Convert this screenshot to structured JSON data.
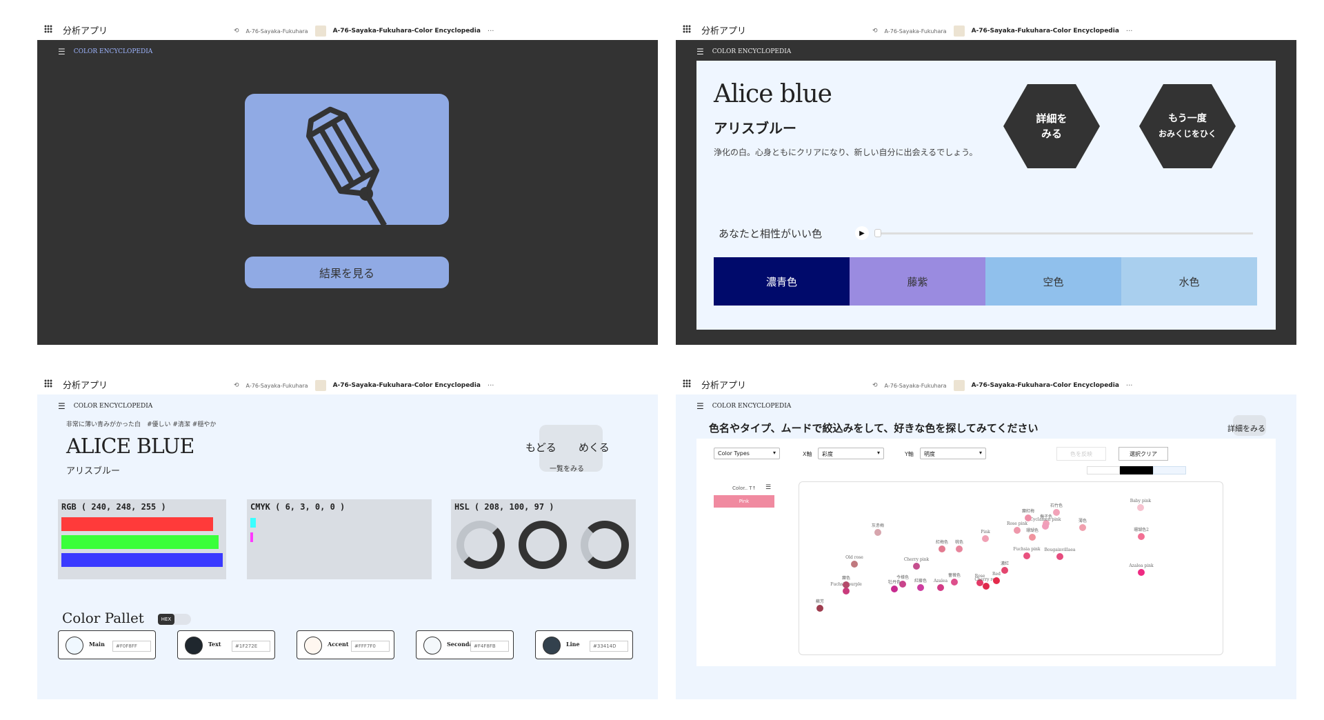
{
  "window": {
    "app_name": "分析アプリ",
    "owner": "A-76-Sayaka-Fukuhara",
    "doc_title": "A-76-Sayaka-Fukuhara-Color Encyclopedia",
    "more": "···"
  },
  "brand": "COLOR ENCYCLOPEDIA",
  "screen1": {
    "result_button": "結果を見る",
    "card_color": "#90aae4"
  },
  "screen2": {
    "name_en": "Alice blue",
    "name_ja": "アリスブルー",
    "description": "浄化の白。心身ともにクリアになり、新しい自分に出会えるでしょう。",
    "detail_button": [
      "詳細を",
      "みる"
    ],
    "retry_button": [
      "もう一度",
      "おみくじをひく"
    ],
    "match_label": "あなたと相性がいい色",
    "matches": [
      {
        "name": "濃青色",
        "color": "#000a6b",
        "text_color": "#ffffff"
      },
      {
        "name": "藤紫",
        "color": "#9a8be0",
        "text_color": "#333333"
      },
      {
        "name": "空色",
        "color": "#90c0ec",
        "text_color": "#333333"
      },
      {
        "name": "水色",
        "color": "#a9cfee",
        "text_color": "#333333"
      }
    ]
  },
  "screen3": {
    "tags": "非常に薄い青みがかった白　#優しい #清潔 #穏やか",
    "title": "ALICE BLUE",
    "kana": "アリスブルー",
    "nav_back": "もどる",
    "nav_next": "めくる",
    "nav_list": "一覧をみる",
    "rgb_label": "RGB ( 240, 248, 255 )",
    "rgb_values": [
      240,
      248,
      255
    ],
    "cmyk_label": "CMYK ( 6, 3, 0, 0 )",
    "cmyk_values": [
      6,
      3,
      0,
      0
    ],
    "hsl_label": "HSL ( 208, 100, 97 )",
    "hsl_values": [
      208,
      100,
      97
    ],
    "pallet_title": "Color Pallet",
    "toggle_label": "HEX",
    "pallet": [
      {
        "name": "Main",
        "hex": "#F0F8FF",
        "color": "#f0f8ff"
      },
      {
        "name": "Text",
        "hex": "#1F272E",
        "color": "#1f272e"
      },
      {
        "name": "Accent",
        "hex": "#FFF7F0",
        "color": "#fff7f0"
      },
      {
        "name": "Secondary",
        "hex": "#F4F8FB",
        "color": "#f4f8fb"
      },
      {
        "name": "Line",
        "hex": "#33414D",
        "color": "#33414d"
      }
    ]
  },
  "screen4": {
    "title": "色名やタイプ、ムードで絞込みをして、好きな色を探してみてください",
    "detail_link": "詳細をみる",
    "color_types": "Color Types",
    "x_axis_label": "X軸",
    "x_axis_value": "彩度",
    "y_axis_label": "Y軸",
    "y_axis_value": "明度",
    "ghost_button": "色を反映",
    "clear_button": "選択クリア",
    "filter_header": "Color.. T↑",
    "filter_chip": "Pink",
    "points": [
      {
        "label": "蘇芳",
        "color": "#9e3d4f"
      },
      {
        "label": "Old rose",
        "color": "#c0797f"
      },
      {
        "label": "灰赤梅",
        "color": "#d7a5ad"
      },
      {
        "label": "Fuchsia purple",
        "color": "#c93b7c"
      },
      {
        "label": "躑色",
        "color": "#b44b6b"
      },
      {
        "label": "Cherry pink",
        "color": "#c54f8e"
      },
      {
        "label": "今様色",
        "color": "#c9448b"
      },
      {
        "label": "牡丹色",
        "color": "#c72b8f"
      },
      {
        "label": "紅藤色",
        "color": "#cd3ca0"
      },
      {
        "label": "Azalea",
        "color": "#d33a86"
      },
      {
        "label": "紅梅色",
        "color": "#e27a8f"
      },
      {
        "label": "桃色",
        "color": "#e7859c"
      },
      {
        "label": "薔薇色",
        "color": "#dd4f8c"
      },
      {
        "label": "Rose",
        "color": "#e43a67"
      },
      {
        "label": "Cherry red",
        "color": "#df2a4c"
      },
      {
        "label": "Red",
        "color": "#e42a4b"
      },
      {
        "label": "濃紅",
        "color": "#e3466f"
      },
      {
        "label": "Pink",
        "color": "#f0a0b4"
      },
      {
        "label": "Rose pink",
        "color": "#ee98ab"
      },
      {
        "label": "Fuchsia pink",
        "color": "#e9517f"
      },
      {
        "label": "撫子色",
        "color": "#f1a2b8"
      },
      {
        "label": "Cyclamen pink",
        "color": "#f09dba"
      },
      {
        "label": "石竹色",
        "color": "#f2a3b9"
      },
      {
        "label": "珊瑚色",
        "color": "#f0949e"
      },
      {
        "label": "躑紅梅",
        "color": "#ee8fa7"
      },
      {
        "label": "Bougainvillaea",
        "color": "#e64c7e"
      },
      {
        "label": "薄色",
        "color": "#f0a0ae"
      },
      {
        "label": "Baby pink",
        "color": "#f6c2cf"
      },
      {
        "label": "珊瑚色2",
        "color": "#f27094"
      },
      {
        "label": "Azalea pink",
        "color": "#ee2a82"
      }
    ]
  }
}
